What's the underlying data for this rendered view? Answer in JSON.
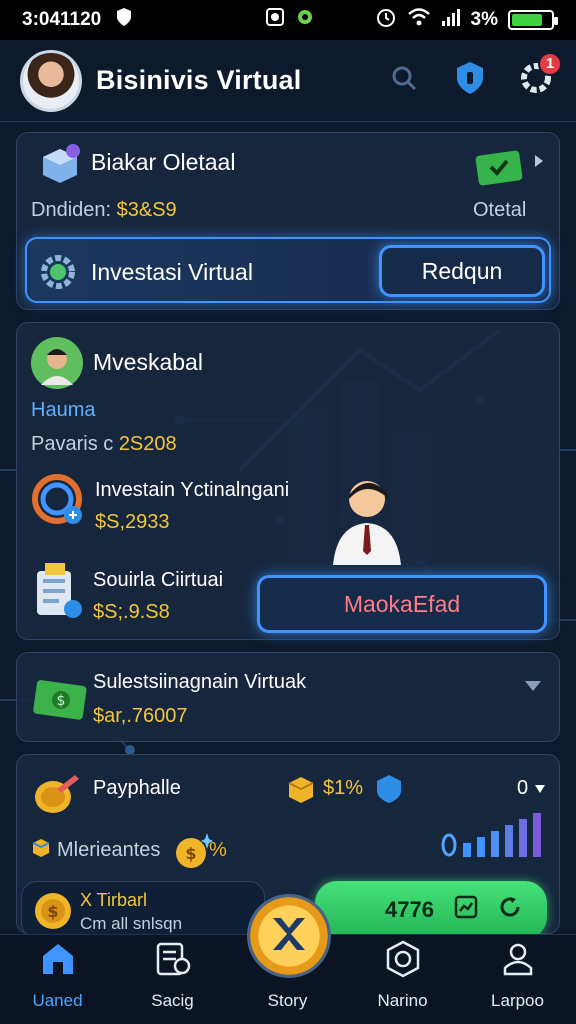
{
  "status_bar": {
    "time": "3:041120",
    "battery": "3%",
    "battery_level": 0.8,
    "icons": [
      "shield-icon",
      "record-icon",
      "gear-icon",
      "alarm-icon",
      "wifi-icon",
      "signal-icon",
      "battery-icon"
    ]
  },
  "header": {
    "title": "Bisinivis Virtual",
    "notification_count": "1",
    "icons": [
      "search-icon",
      "shield-icon",
      "settings-icon"
    ]
  },
  "card1": {
    "title": "Biakar Oletaal",
    "balance_label": "Dndiden:",
    "balance_value": "$3&S9",
    "right_label": "Otetal",
    "row_label": "Investasi Virtual",
    "row_button": "Redqun"
  },
  "card2": {
    "profile_name": "Mveskabal",
    "profile_role": "Hauma",
    "balance_label": "Pavaris c",
    "balance_value": "2S208",
    "item1_title": "Investain Yctinalngani",
    "item1_value": "$S,2933",
    "item2_title": "Souirla Ciirtuai",
    "item2_value": "$S;.9.S8",
    "action_button": "MaokaEfad"
  },
  "card3": {
    "title": "Sulestsiinagnain Virtuak",
    "value": "$ar,.76007"
  },
  "card4": {
    "title": "Payphalle",
    "badge_value": "$1%",
    "corner_label": "0",
    "stat_label": "Mlerieantes",
    "stat_suffix": "%",
    "left_pill_title": "X Tirbarl",
    "left_pill_subtitle": "Cm all snlsqn",
    "green_pill_value": "4776"
  },
  "nav": {
    "items": [
      {
        "label": "Uaned",
        "icon": "home-icon"
      },
      {
        "label": "Sacig",
        "icon": "tools-icon"
      },
      {
        "label": "Story",
        "icon": "x-icon"
      },
      {
        "label": "Narino",
        "icon": "hexagon-icon"
      },
      {
        "label": "Larpoo",
        "icon": "user-icon"
      }
    ]
  },
  "colors": {
    "background": "#0d1a2b",
    "card": "#182840",
    "accent_blue": "#3f94ff",
    "gold": "#f3c640",
    "green": "#46e27a",
    "red_badge": "#e43a43"
  }
}
